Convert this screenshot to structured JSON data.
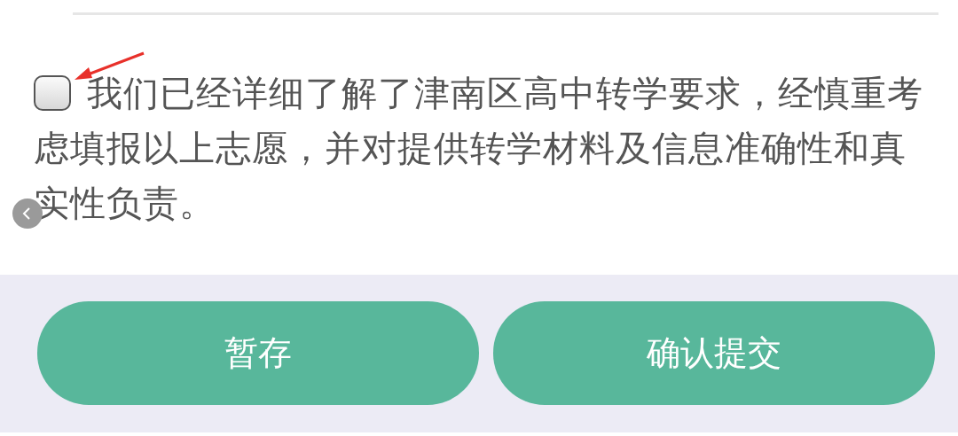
{
  "agreement": {
    "checked": false,
    "text_lines": [
      "我们已经详细了解了津南区高中转学要求，经慎重考",
      "虑填报以上志愿，并对提供转学材料及信息准确性和真实性负责。"
    ]
  },
  "buttons": [
    {
      "label": "暂存"
    },
    {
      "label": "确认提交"
    }
  ]
}
